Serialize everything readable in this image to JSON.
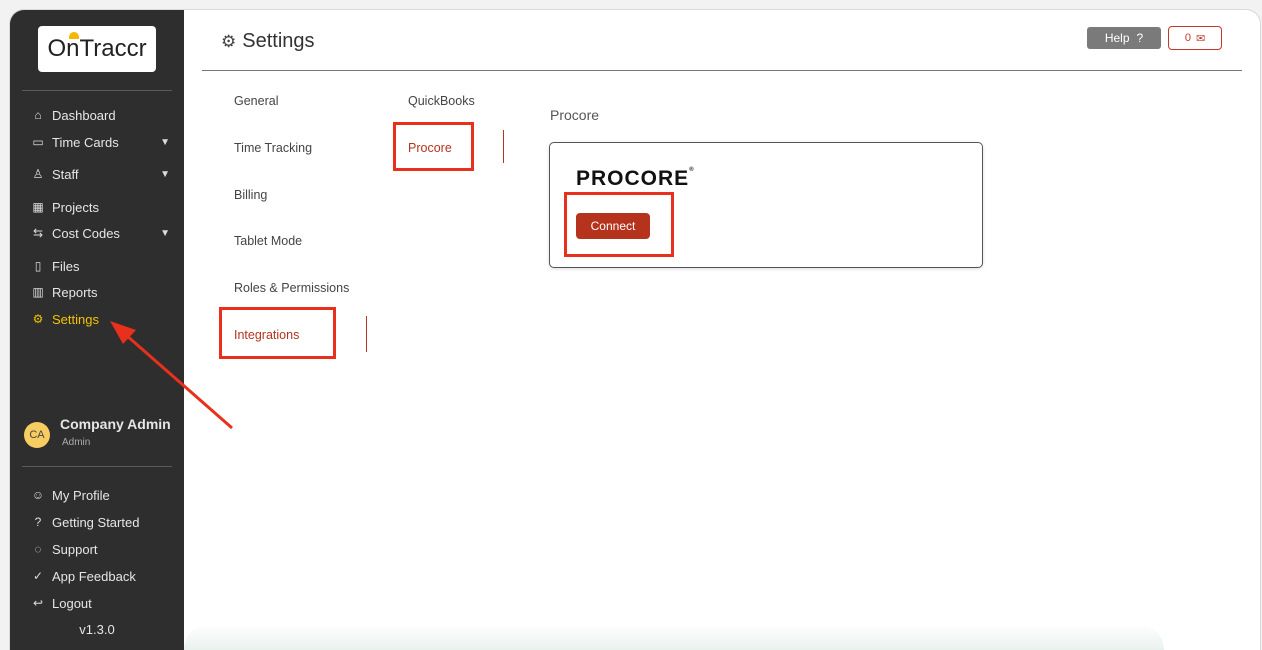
{
  "brand": {
    "logo_text": "OnTraccr",
    "accent": "#b5321c",
    "highlight": "#e8301d",
    "sidebar_active": "#f2c300"
  },
  "sidebar": {
    "items": [
      {
        "label": "Dashboard",
        "icon": "home-icon",
        "chevron": false
      },
      {
        "label": "Time Cards",
        "icon": "calendar-icon",
        "chevron": true
      },
      {
        "label": "Staff",
        "icon": "person-icon",
        "chevron": true
      },
      {
        "label": "Projects",
        "icon": "project-board-icon",
        "chevron": false
      },
      {
        "label": "Cost Codes",
        "icon": "swap-icon",
        "chevron": true
      },
      {
        "label": "Files",
        "icon": "file-icon",
        "chevron": false
      },
      {
        "label": "Reports",
        "icon": "bar-chart-icon",
        "chevron": false
      },
      {
        "label": "Settings",
        "icon": "gear-icon",
        "chevron": false,
        "active": true
      }
    ],
    "user": {
      "initials": "CA",
      "name": "Company Admin",
      "role": "Admin"
    },
    "bottom_items": [
      {
        "label": "My Profile",
        "icon": "smile-icon"
      },
      {
        "label": "Getting Started",
        "icon": "question-circle-icon"
      },
      {
        "label": "Support",
        "icon": "chat-icon"
      },
      {
        "label": "App Feedback",
        "icon": "thumbs-up-icon"
      },
      {
        "label": "Logout",
        "icon": "logout-icon"
      }
    ],
    "version": "v1.3.0"
  },
  "header": {
    "title": "Settings",
    "help_label": "Help",
    "notification_count": "0"
  },
  "settings_menu": [
    "General",
    "Time Tracking",
    "Billing",
    "Tablet Mode",
    "Roles & Permissions",
    "Integrations"
  ],
  "settings_selected": "Integrations",
  "integrations_menu": [
    "QuickBooks",
    "Procore"
  ],
  "integrations_selected": "Procore",
  "procore": {
    "section_title": "Procore",
    "logo_text": "PROCORE",
    "connect_label": "Connect"
  }
}
